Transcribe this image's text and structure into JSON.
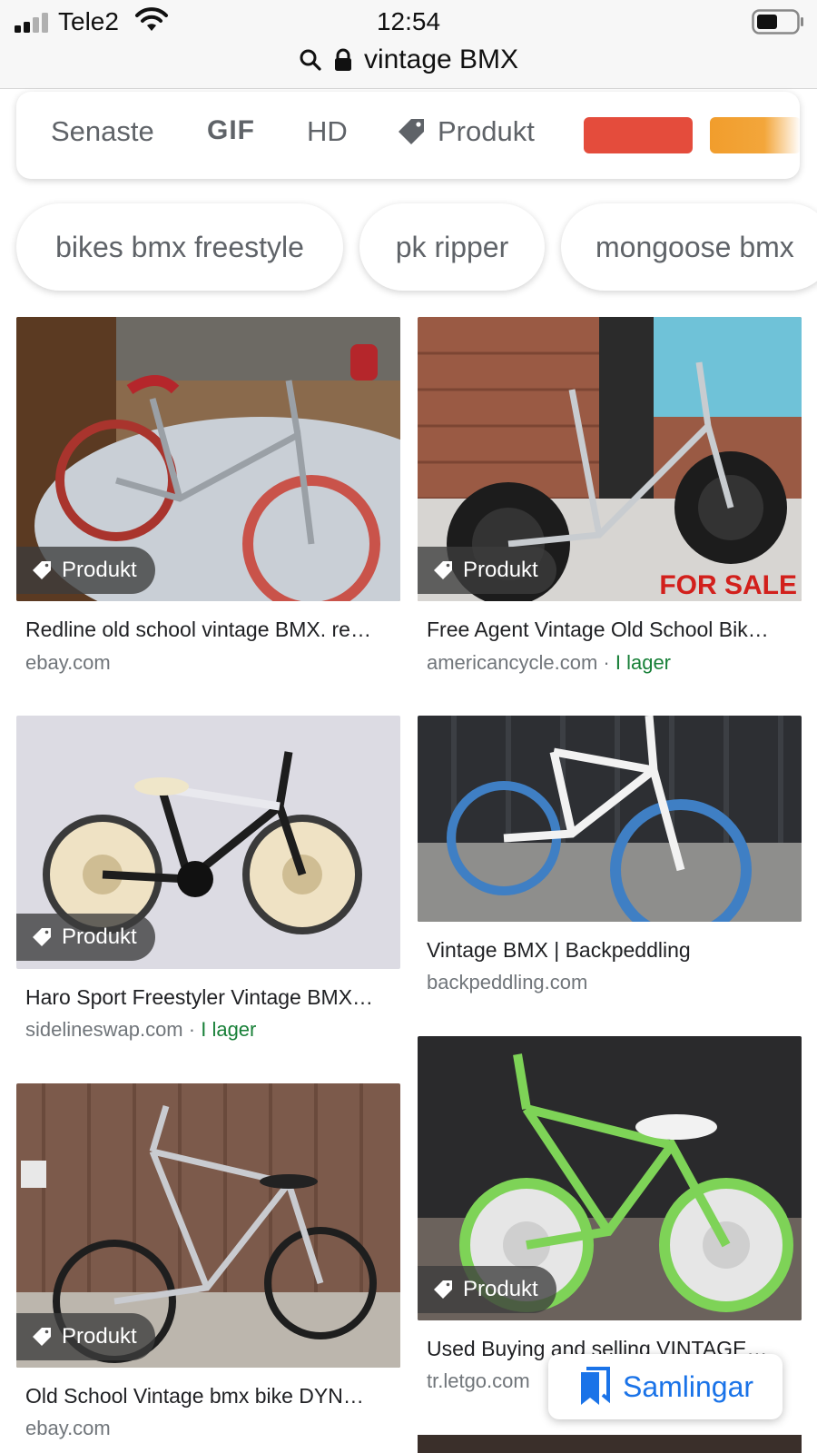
{
  "status_bar": {
    "carrier": "Tele2",
    "time": "12:54",
    "icons": [
      "signal-icon",
      "wifi-icon",
      "battery-icon"
    ]
  },
  "url_bar": {
    "text": "vintage BMX",
    "icons": [
      "search-icon",
      "lock-icon"
    ]
  },
  "filters": {
    "senaste": "Senaste",
    "gif": "GIF",
    "hd": "HD",
    "produkt": "Produkt",
    "color_swatches": [
      "#e44c3c",
      "#f19d2c"
    ]
  },
  "suggestions": [
    "bikes bmx freestyle",
    "pk ripper",
    "mongoose bmx"
  ],
  "badge_label": "Produkt",
  "results": [
    {
      "title": "Redline old school vintage BMX. re…",
      "source": "ebay.com",
      "stock": "",
      "badge": true
    },
    {
      "title": "Free Agent Vintage Old School Bik…",
      "source": "americancycle.com",
      "stock": "I lager",
      "badge": true,
      "image_text": "FOR SALE"
    },
    {
      "title": "Haro Sport Freestyler Vintage BMX…",
      "source": "sidelineswap.com",
      "stock": "I lager",
      "badge": true
    },
    {
      "title": "Vintage BMX | Backpeddling",
      "source": "backpeddling.com",
      "stock": "",
      "badge": false
    },
    {
      "title": "Old School Vintage bmx bike DYN…",
      "source": "ebay.com",
      "stock": "",
      "badge": true
    },
    {
      "title": "Used Buying and selling VINTAGE…",
      "source": "tr.letgo.com",
      "stock": "",
      "badge": true
    }
  ],
  "stock_separator": "·",
  "collections_button": {
    "label": "Samlingar",
    "icon": "bookmark-icon"
  },
  "colors": {
    "accent_blue": "#1a73e8",
    "stock_green": "#188038"
  }
}
